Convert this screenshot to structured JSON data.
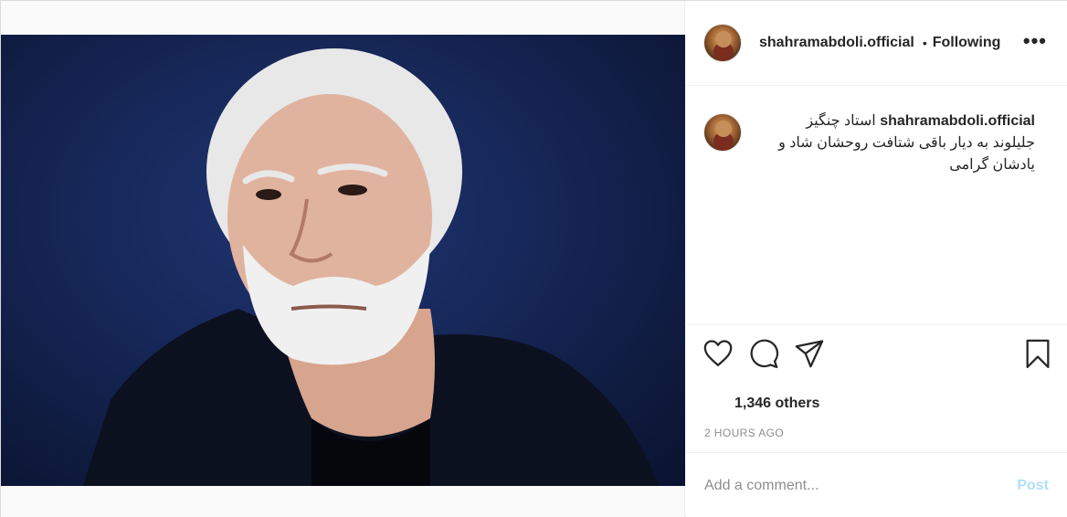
{
  "post": {
    "username": "shahramabdoli.official",
    "follow_separator": "•",
    "follow_status": "Following",
    "more_label": "•••"
  },
  "caption": {
    "username": "shahramabdoli.official",
    "text": "استاد چنگیز جلیلوند به دیار باقی شتافت روحشان شاد و یادشان گرامی"
  },
  "actions": {
    "icons": [
      "heart-icon",
      "comment-icon",
      "share-icon",
      "bookmark-icon"
    ]
  },
  "likes": {
    "text": "1,346 others"
  },
  "timestamp": "2 HOURS AGO",
  "comment": {
    "placeholder": "Add a comment...",
    "post_label": "Post"
  },
  "colors": {
    "photo_background": "#17285a",
    "post_button_disabled": "#b2dffc",
    "meta_gray": "#8e8e8e"
  }
}
